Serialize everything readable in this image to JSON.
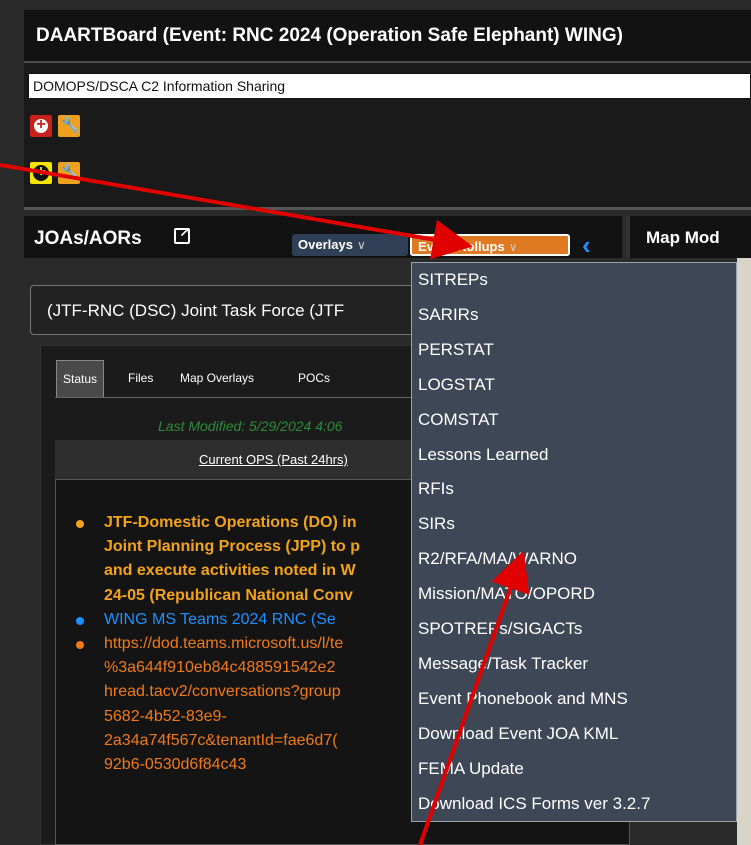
{
  "window": {
    "title": "DAARTBoard (Event: RNC 2024 (Operation Safe Elephant) WING)"
  },
  "info_panel": {
    "label": "DOMOPS/DSCA C2 Information Sharing",
    "icons": [
      "add-icon",
      "wrench-icon",
      "add-icon",
      "wrench-icon"
    ]
  },
  "joa_panel": {
    "title": "JOAs/AORs",
    "overlays_label": "Overlays",
    "rollups_label": "Event Rollups",
    "selected_joa": "(JTF-RNC (DSC) Joint Task Force (JTF",
    "tabs": [
      "Status",
      "Files",
      "Map Overlays",
      "POCs"
    ],
    "last_modified": "Last Modified: 5/29/2024 4:06",
    "ops_header": "Current OPS (Past 24hrs)",
    "ops_lines": [
      {
        "text": "JTF-Domestic Operations (DO) in",
        "style": "orange-b",
        "bullet": "#f2a31a"
      },
      {
        "text": "Joint Planning Process (JPP) to p",
        "style": "orange-b",
        "bullet": ""
      },
      {
        "text": "and execute activities noted in W",
        "style": "orange-b",
        "bullet": ""
      },
      {
        "text": "24-05 (Republican National Conv",
        "style": "orange-b",
        "bullet": ""
      },
      {
        "text": "WING MS Teams 2024 RNC (Se",
        "style": "blue",
        "bullet": "#1e90ff"
      },
      {
        "text": "https://dod.teams.microsoft.us/l/te",
        "style": "orange",
        "bullet": "#f07a1a"
      },
      {
        "text": "%3a644f910eb84c488591542e2",
        "style": "orange",
        "bullet": ""
      },
      {
        "text": "hread.tacv2/conversations?group",
        "style": "orange",
        "bullet": ""
      },
      {
        "text": "5682-4b52-83e9-",
        "style": "orange",
        "bullet": ""
      },
      {
        "text": "2a34a74f567c&tenantId=fae6d7(",
        "style": "orange",
        "bullet": ""
      },
      {
        "text": "92b6-0530d6f84c43",
        "style": "orange",
        "bullet": ""
      }
    ]
  },
  "map_panel": {
    "title": "Map Mod"
  },
  "rollups_menu": {
    "items": [
      "SITREPs",
      "SARIRs",
      "PERSTAT",
      "LOGSTAT",
      "COMSTAT",
      "Lessons Learned",
      "RFIs",
      "SIRs",
      "R2/RFA/MA/WARNO",
      "Mission/MATO/OPORD",
      "SPOTREPs/SIGACTs",
      "Message/Task Tracker",
      "Event Phonebook and MNS",
      "Download Event JOA KML",
      "FEMA Update",
      "Download ICS Forms ver 3.2.7"
    ]
  },
  "colors": {
    "accent_orange": "#e07a22",
    "link_blue": "#1e90ff",
    "annotation_red": "#e00000"
  }
}
